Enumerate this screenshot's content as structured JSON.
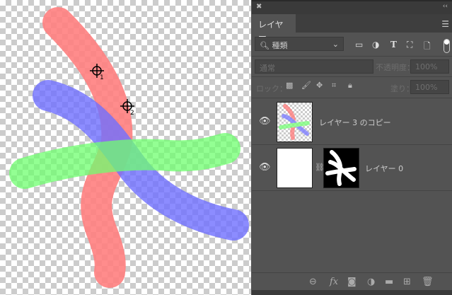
{
  "canvas": {
    "stroke_colors": {
      "red": "#ff7f7f",
      "blue": "#7f7fff",
      "green": "#7fff7f"
    },
    "markers": [
      {
        "label": "1"
      },
      {
        "label": "2"
      }
    ]
  },
  "panel": {
    "close_icon": "close-icon",
    "collapse_icon": "double-chevron-icon",
    "tab": "レイヤー",
    "filter": {
      "value": "種類",
      "icons": [
        "image-filter-icon",
        "adjustment-filter-icon",
        "type-filter-icon",
        "shape-filter-icon",
        "smart-object-filter-icon",
        "filter-toggle"
      ]
    },
    "blend_mode": "通常",
    "opacity_label": "不透明度：",
    "opacity": "100%",
    "lock_label": "ロック：",
    "fill_label": "塗り：",
    "fill": "100%",
    "layers": [
      {
        "name": "レイヤー 3 のコピー",
        "visible": true
      },
      {
        "name": "レイヤー 0",
        "visible": true,
        "has_mask": true
      }
    ],
    "bottom_icons": [
      "link-icon",
      "fx-icon",
      "mask-icon",
      "adjustment-icon",
      "folder-icon",
      "new-layer-icon",
      "trash-icon"
    ]
  }
}
